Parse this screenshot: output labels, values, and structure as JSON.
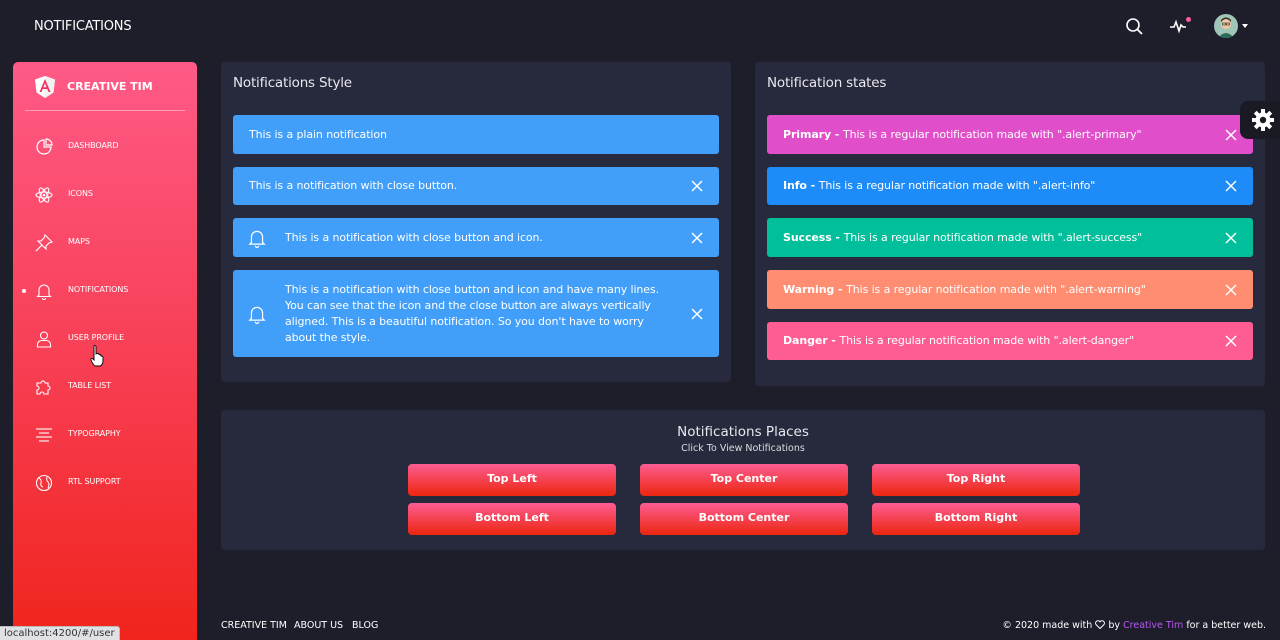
{
  "header": {
    "title": "NOTIFICATIONS",
    "icons": [
      "search-icon",
      "activity-icon",
      "avatar"
    ]
  },
  "sidebar": {
    "brand": "CREATIVE TIM",
    "items": [
      {
        "label": "DASHBOARD",
        "icon": "dashboard-icon"
      },
      {
        "label": "ICONS",
        "icon": "atom-icon"
      },
      {
        "label": "MAPS",
        "icon": "pin-icon"
      },
      {
        "label": "NOTIFICATIONS",
        "icon": "bell-icon",
        "active": true
      },
      {
        "label": "USER PROFILE",
        "icon": "user-icon"
      },
      {
        "label": "TABLE LIST",
        "icon": "puzzle-icon"
      },
      {
        "label": "TYPOGRAPHY",
        "icon": "align-center-icon"
      },
      {
        "label": "RTL SUPPORT",
        "icon": "world-icon"
      }
    ]
  },
  "styles_card": {
    "title": "Notifications Style",
    "alerts": [
      "This is a plain notification",
      "This is a notification with close button.",
      "This is a notification with close button and icon.",
      "This is a notification with close button and icon and have many lines. You can see that the icon and the close button are always vertically aligned. This is a beautiful notification. So you don't have to worry about the style."
    ]
  },
  "states_card": {
    "title": "Notification states",
    "alerts": [
      {
        "label": "Primary - ",
        "text": "This is a regular notification made with \".alert-primary\""
      },
      {
        "label": "Info - ",
        "text": "This is a regular notification made with \".alert-info\""
      },
      {
        "label": "Success - ",
        "text": "This is a regular notification made with \".alert-success\""
      },
      {
        "label": "Warning - ",
        "text": "This is a regular notification made with \".alert-warning\""
      },
      {
        "label": "Danger - ",
        "text": "This is a regular notification made with \".alert-danger\""
      }
    ]
  },
  "places_card": {
    "title": "Notifications Places",
    "subtitle": "Click To View Notifications",
    "buttons": [
      "Top Left",
      "Top Center",
      "Top Right",
      "Bottom Left",
      "Bottom Center",
      "Bottom Right"
    ]
  },
  "footer": {
    "links": [
      "CREATIVE TIM",
      "ABOUT US",
      "BLOG"
    ],
    "copyright_prefix": "© 2020 made with",
    "by": "by",
    "author": "Creative Tim",
    "suffix": "for a better web."
  },
  "status_bar": {
    "url": "localhost:4200/#/user"
  },
  "colors": {
    "background": "#1e1e2b",
    "card": "#27293d",
    "primary": "#e14eca",
    "info": "#1d8cf8",
    "success": "#00bf9a",
    "warning": "#ff8d72",
    "danger": "#fd5d93",
    "accent_link": "#ba54f5"
  }
}
